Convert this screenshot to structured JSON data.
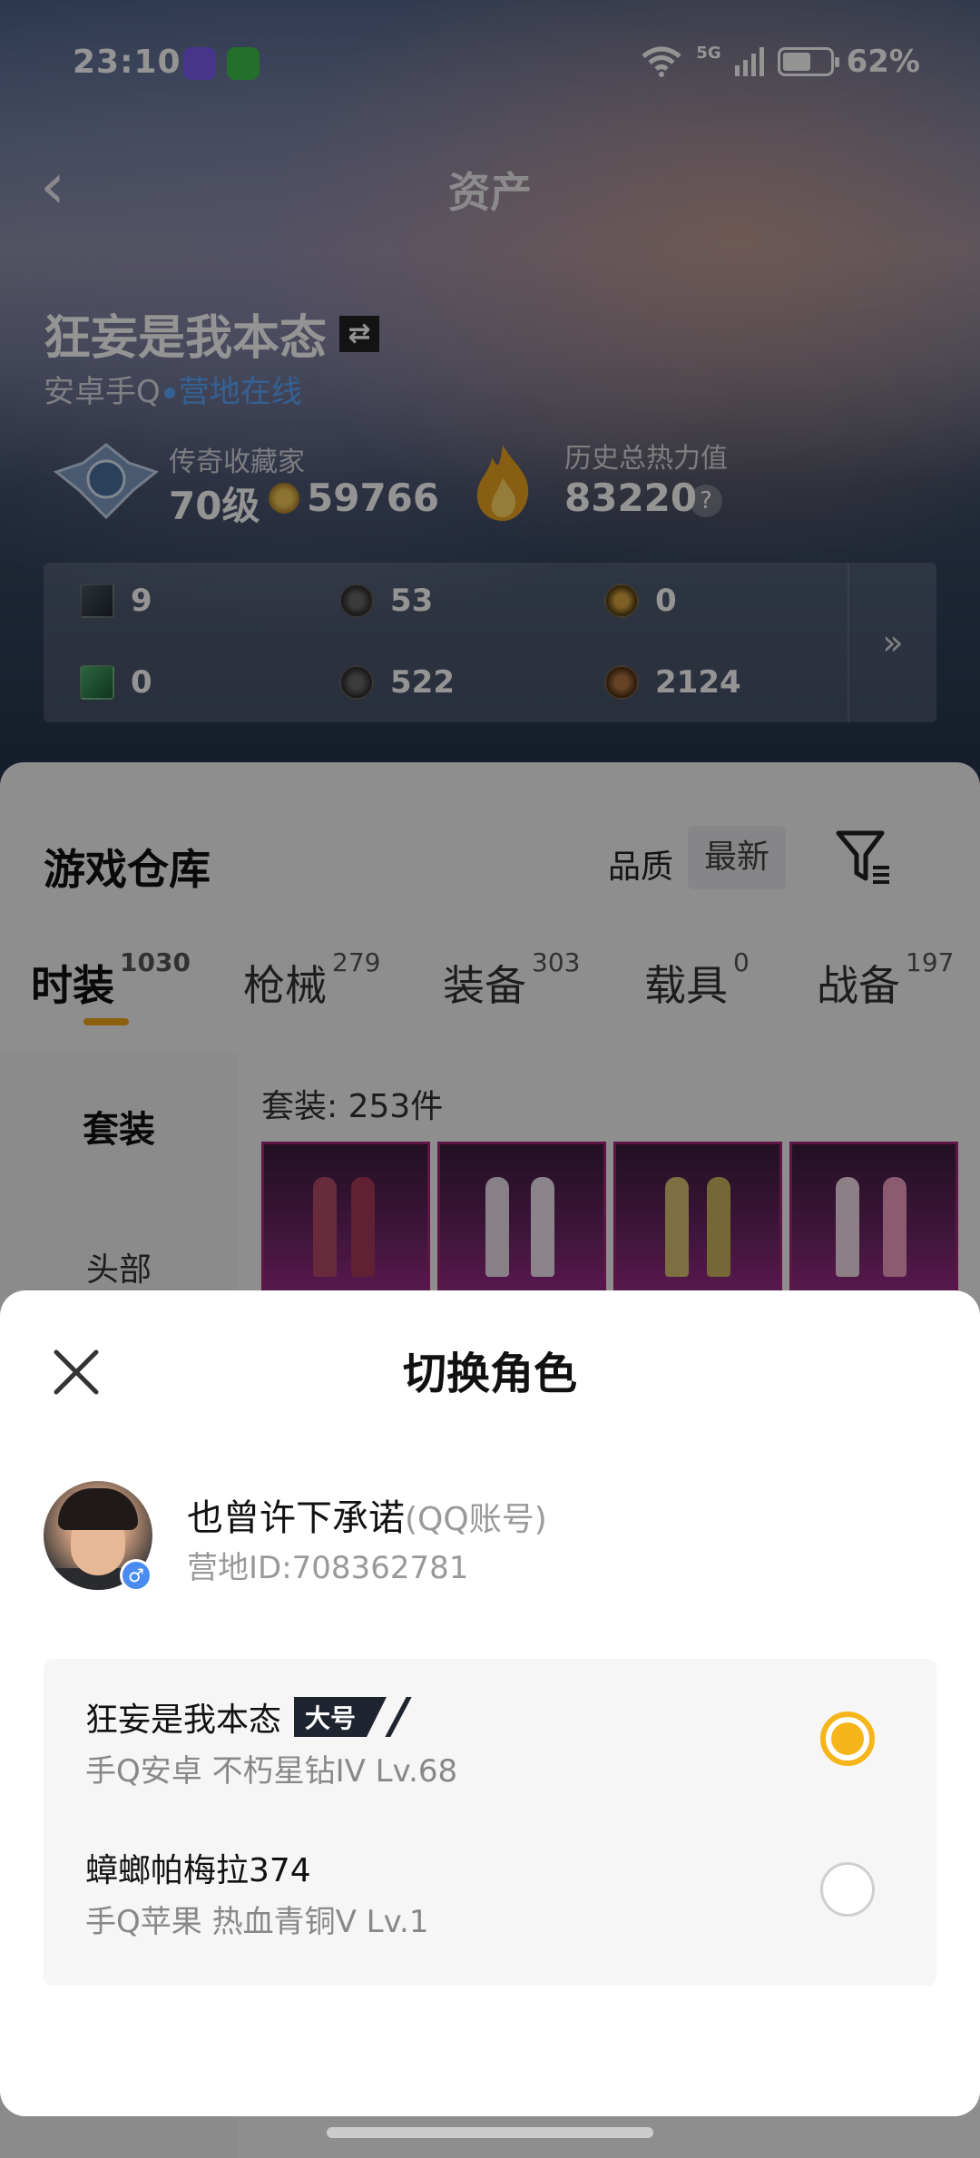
{
  "status_bar": {
    "time": "23:10",
    "network": "5G",
    "battery": "62%"
  },
  "header": {
    "title": "资产",
    "back_icon": "chevron-left-icon"
  },
  "player": {
    "name": "狂妄是我本态",
    "platform": "安卓手Q",
    "camp_status": "营地在线"
  },
  "stats": {
    "collector_label": "传奇收藏家",
    "level": "70级",
    "coins": "59766",
    "heat_label": "历史总热力值",
    "heat_value": "83220",
    "help": "?"
  },
  "assets": [
    {
      "icon": "card-icon",
      "value": "9"
    },
    {
      "icon": "coin-silver-icon",
      "value": "53"
    },
    {
      "icon": "coin-gold-icon",
      "value": "0"
    },
    {
      "icon": "green-card-icon",
      "value": "0"
    },
    {
      "icon": "coin-dark-icon",
      "value": "522"
    },
    {
      "icon": "coin-bronze-icon",
      "value": "2124"
    }
  ],
  "assets_more": "»",
  "warehouse": {
    "title": "游戏仓库",
    "sort_label": "品质",
    "sort_value": "最新",
    "tabs": [
      {
        "label": "时装",
        "count": "1030"
      },
      {
        "label": "枪械",
        "count": "279"
      },
      {
        "label": "装备",
        "count": "303"
      },
      {
        "label": "载具",
        "count": "0"
      },
      {
        "label": "战备",
        "count": "197"
      }
    ],
    "side": [
      "套装",
      "头部"
    ],
    "set_count": "套装: 253件"
  },
  "sheet": {
    "title": "切换角色",
    "account": {
      "name": "也曾许下承诺",
      "tag": "(QQ账号)",
      "id": "营地ID:708362781",
      "gender": "♂"
    },
    "roles": [
      {
        "name": "狂妄是我本态",
        "badge": "大号",
        "detail": "手Q安卓  不朽星钻IV  Lv.68",
        "selected": true
      },
      {
        "name": "蟑螂帕梅拉374",
        "badge": "",
        "detail": "手Q苹果  热血青铜V  Lv.1",
        "selected": false
      }
    ]
  },
  "colors": {
    "accent": "#f6b51b",
    "online": "#5aa8ff",
    "thumb_border": "#a22578"
  }
}
